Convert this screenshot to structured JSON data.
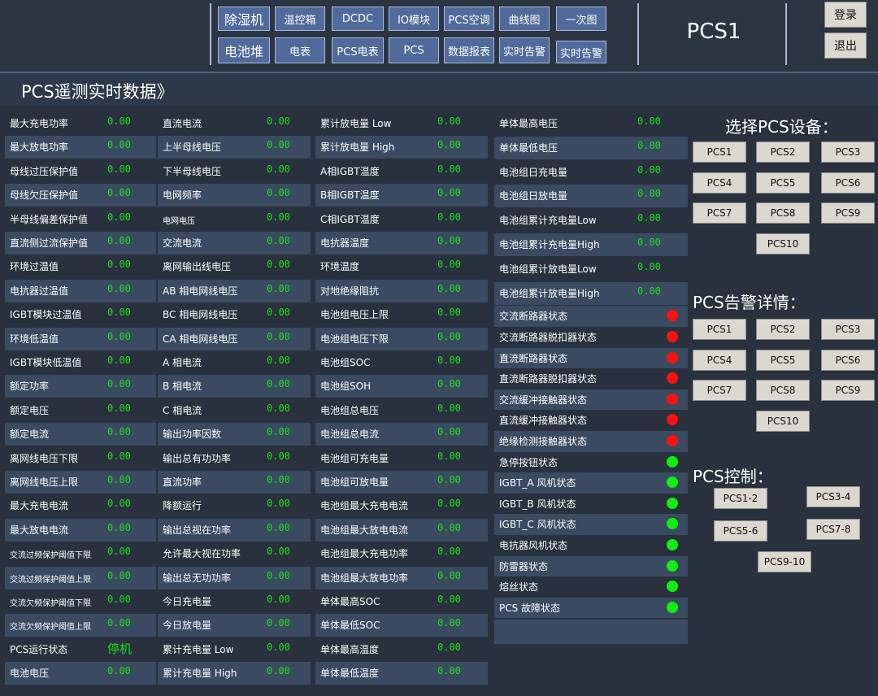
{
  "nav": {
    "row1": [
      "除湿机",
      "温控箱",
      "DCDC",
      "IO模块",
      "PCS空调",
      "曲线图",
      "一次图"
    ],
    "row2": [
      "电池堆",
      "电表",
      "PCS电表",
      "PCS",
      "数据报表",
      "实时告警",
      "实时告警"
    ]
  },
  "device_title": "PCS1",
  "login_label": "登录",
  "logout_label": "退出",
  "page_title": "PCS遥测实时数据》",
  "columns": [
    [
      {
        "label": "最大充电功率",
        "value": "0.00"
      },
      {
        "label": "最大放电功率",
        "value": "0.00"
      },
      {
        "label": "母线过压保护值",
        "value": "0.00"
      },
      {
        "label": "母线欠压保护值",
        "value": "0.00"
      },
      {
        "label": "半母线偏差保护值",
        "value": "0.00"
      },
      {
        "label": "直流侧过流保护值",
        "value": "0.00"
      },
      {
        "label": "环境过温值",
        "value": "0.00"
      },
      {
        "label": "电抗器过温值",
        "value": "0.00"
      },
      {
        "label": "IGBT模块过温值",
        "value": "0.00"
      },
      {
        "label": "环境低温值",
        "value": "0.00"
      },
      {
        "label": "IGBT模块低温值",
        "value": "0.00"
      },
      {
        "label": "额定功率",
        "value": "0.00"
      },
      {
        "label": "额定电压",
        "value": "0.00"
      },
      {
        "label": "额定电流",
        "value": "0.00"
      },
      {
        "label": "离网线电压下限",
        "value": "0.00"
      },
      {
        "label": "离网线电压上限",
        "value": "0.00"
      },
      {
        "label": "最大充电电流",
        "value": "0.00"
      },
      {
        "label": "最大放电电流",
        "value": "0.00"
      },
      {
        "label": "交流过频保护阈值下限",
        "value": "0.00"
      },
      {
        "label": "交流过频保护阈值上限",
        "value": "0.00"
      },
      {
        "label": "交流欠频保护阈值下限",
        "value": "0.00"
      },
      {
        "label": "交流欠频保护阈值上限",
        "value": "0.00"
      },
      {
        "label": "PCS运行状态",
        "value": "停机"
      },
      {
        "label": "电池电压",
        "value": "0.00"
      }
    ],
    [
      {
        "label": "直流电流",
        "value": "0.00"
      },
      {
        "label": "上半母线电压",
        "value": "0.00"
      },
      {
        "label": "下半母线电压",
        "value": "0.00"
      },
      {
        "label": "电网频率",
        "value": "0.00"
      },
      {
        "label": "电网电压",
        "value": "0.00"
      },
      {
        "label": "交流电流",
        "value": "0.00"
      },
      {
        "label": "离网输出线电压",
        "value": "0.00"
      },
      {
        "label": "AB 相电网线电压",
        "value": "0.00"
      },
      {
        "label": "BC 相电网线电压",
        "value": "0.00"
      },
      {
        "label": "CA 相电网线电压",
        "value": "0.00"
      },
      {
        "label": "A 相电流",
        "value": "0.00"
      },
      {
        "label": "B 相电流",
        "value": "0.00"
      },
      {
        "label": "C 相电流",
        "value": "0.00"
      },
      {
        "label": "输出功率因数",
        "value": "0.00"
      },
      {
        "label": "输出总有功功率",
        "value": "0.00"
      },
      {
        "label": "直流功率",
        "value": "0.00"
      },
      {
        "label": "降额运行",
        "value": "0.00"
      },
      {
        "label": "输出总视在功率",
        "value": "0.00"
      },
      {
        "label": "允许最大视在功率",
        "value": "0.00"
      },
      {
        "label": "输出总无功功率",
        "value": "0.00"
      },
      {
        "label": "今日充电量",
        "value": "0.00"
      },
      {
        "label": "今日放电量",
        "value": "0.00"
      },
      {
        "label": "累计充电量 Low",
        "value": "0.00"
      },
      {
        "label": "累计充电量 High",
        "value": "0.00"
      }
    ],
    [
      {
        "label": "累计放电量 Low",
        "value": "0.00"
      },
      {
        "label": "累计放电量 High",
        "value": "0.00"
      },
      {
        "label": "A相IGBT温度",
        "value": "0.00"
      },
      {
        "label": "B相IGBT温度",
        "value": "0.00"
      },
      {
        "label": "C相IGBT温度",
        "value": "0.00"
      },
      {
        "label": "电抗器温度",
        "value": "0.00"
      },
      {
        "label": "环境温度",
        "value": "0.00"
      },
      {
        "label": "对地绝缘阻抗",
        "value": "0.00"
      },
      {
        "label": "电池组电压上限",
        "value": "0.00"
      },
      {
        "label": "电池组电压下限",
        "value": "0.00"
      },
      {
        "label": "电池组SOC",
        "value": "0.00"
      },
      {
        "label": "电池组SOH",
        "value": "0.00"
      },
      {
        "label": "电池组总电压",
        "value": "0.00"
      },
      {
        "label": "电池组总电流",
        "value": "0.00"
      },
      {
        "label": "电池组可充电量",
        "value": "0.00"
      },
      {
        "label": "电池组可放电量",
        "value": "0.00"
      },
      {
        "label": "电池组最大充电电流",
        "value": "0.00"
      },
      {
        "label": "电池组最大放电电流",
        "value": "0.00"
      },
      {
        "label": "电池组最大充电功率",
        "value": "0.00"
      },
      {
        "label": "电池组最大放电功率",
        "value": "0.00"
      },
      {
        "label": "单体最高SOC",
        "value": "0.00"
      },
      {
        "label": "单体最低SOC",
        "value": "0.00"
      },
      {
        "label": "单体最高温度",
        "value": "0.00"
      },
      {
        "label": "单体最低温度",
        "value": "0.00"
      }
    ]
  ],
  "col4_values": [
    {
      "label": "单体最高电压",
      "value": "0.00"
    },
    {
      "label": "单体最低电压",
      "value": "0.00"
    },
    {
      "label": "电池组日充电量",
      "value": "0.00"
    },
    {
      "label": "电池组日放电量",
      "value": "0.00"
    },
    {
      "label": "电池组累计充电量Low",
      "value": "0.00"
    },
    {
      "label": "电池组累计充电量High",
      "value": "0.00"
    },
    {
      "label": "电池组累计放电量Low",
      "value": "0.00"
    },
    {
      "label": "电池组累计放电量High",
      "value": "0.00"
    }
  ],
  "col4_status": [
    {
      "label": "交流断路器状态",
      "state": "red"
    },
    {
      "label": "交流断路器脱扣器状态",
      "state": "red"
    },
    {
      "label": "直流断路器状态",
      "state": "red"
    },
    {
      "label": "直流断路器脱扣器状态",
      "state": "red"
    },
    {
      "label": "交流缓冲接触器状态",
      "state": "red"
    },
    {
      "label": "直流缓冲接触器状态",
      "state": "red"
    },
    {
      "label": "绝缘检测接触器状态",
      "state": "red"
    },
    {
      "label": "急停按钮状态",
      "state": "green"
    },
    {
      "label": "IGBT_A 风机状态",
      "state": "green"
    },
    {
      "label": "IGBT_B 风机状态",
      "state": "green"
    },
    {
      "label": "IGBT_C 风机状态",
      "state": "green"
    },
    {
      "label": "电抗器风机状态",
      "state": "green"
    },
    {
      "label": "防雷器状态",
      "state": "green"
    },
    {
      "label": "熔丝状态",
      "state": "green"
    },
    {
      "label": "PCS 故障状态",
      "state": "green"
    }
  ],
  "colors": {
    "red": "#ff1010",
    "green": "#10ee10"
  },
  "select_title": "选择PCS设备：",
  "select_buttons": [
    "PCS1",
    "PCS2",
    "PCS3",
    "PCS4",
    "PCS5",
    "PCS6",
    "PCS7",
    "PCS8",
    "PCS9",
    "PCS10"
  ],
  "alarm_title": "PCS告警详情：",
  "alarm_buttons": [
    "PCS1",
    "PCS2",
    "PCS3",
    "PCS4",
    "PCS5",
    "PCS6",
    "PCS7",
    "PCS8",
    "PCS9",
    "PCS10"
  ],
  "control_title": "PCS控制：",
  "control_buttons": [
    "PCS1-2",
    "PCS3-4",
    "PCS5-6",
    "PCS7-8",
    "PCS9-10"
  ]
}
